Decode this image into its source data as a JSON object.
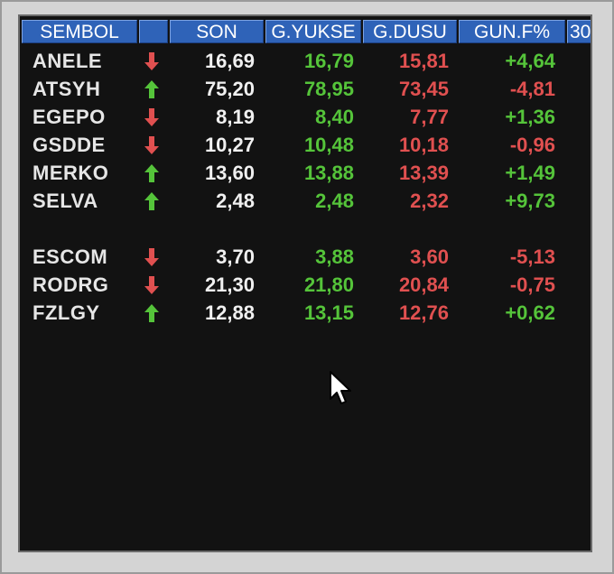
{
  "columns": [
    {
      "key": "symbol",
      "label": "SEMBOL"
    },
    {
      "key": "dir",
      "label": ""
    },
    {
      "key": "son",
      "label": "SON"
    },
    {
      "key": "high",
      "label": "G.YUKSE"
    },
    {
      "key": "low",
      "label": "G.DUSU"
    },
    {
      "key": "chg",
      "label": "GUN.F%"
    },
    {
      "key": "extra",
      "label": "30"
    }
  ],
  "groups": [
    [
      {
        "symbol": "ANELE",
        "dir": "down",
        "son": "16,69",
        "high": "16,79",
        "low": "15,81",
        "chg": "+4,64"
      },
      {
        "symbol": "ATSYH",
        "dir": "up",
        "son": "75,20",
        "high": "78,95",
        "low": "73,45",
        "chg": "-4,81"
      },
      {
        "symbol": "EGEPO",
        "dir": "down",
        "son": "8,19",
        "high": "8,40",
        "low": "7,77",
        "chg": "+1,36"
      },
      {
        "symbol": "GSDDE",
        "dir": "down",
        "son": "10,27",
        "high": "10,48",
        "low": "10,18",
        "chg": "-0,96"
      },
      {
        "symbol": "MERKO",
        "dir": "up",
        "son": "13,60",
        "high": "13,88",
        "low": "13,39",
        "chg": "+1,49"
      },
      {
        "symbol": "SELVA",
        "dir": "up",
        "son": "2,48",
        "high": "2,48",
        "low": "2,32",
        "chg": "+9,73"
      }
    ],
    [
      {
        "symbol": "ESCOM",
        "dir": "down",
        "son": "3,70",
        "high": "3,88",
        "low": "3,60",
        "chg": "-5,13"
      },
      {
        "symbol": "RODRG",
        "dir": "down",
        "son": "21,30",
        "high": "21,80",
        "low": "20,84",
        "chg": "-0,75"
      },
      {
        "symbol": "FZLGY",
        "dir": "up",
        "son": "12,88",
        "high": "13,15",
        "low": "12,76",
        "chg": "+0,62"
      }
    ]
  ],
  "colors": {
    "up": "#55c43a",
    "down": "#e05050",
    "header_bg": "#2f63b8",
    "panel_bg": "#121212"
  },
  "icons": {
    "up": "arrow-up-icon",
    "down": "arrow-down-icon",
    "cursor": "mouse-pointer-icon"
  }
}
